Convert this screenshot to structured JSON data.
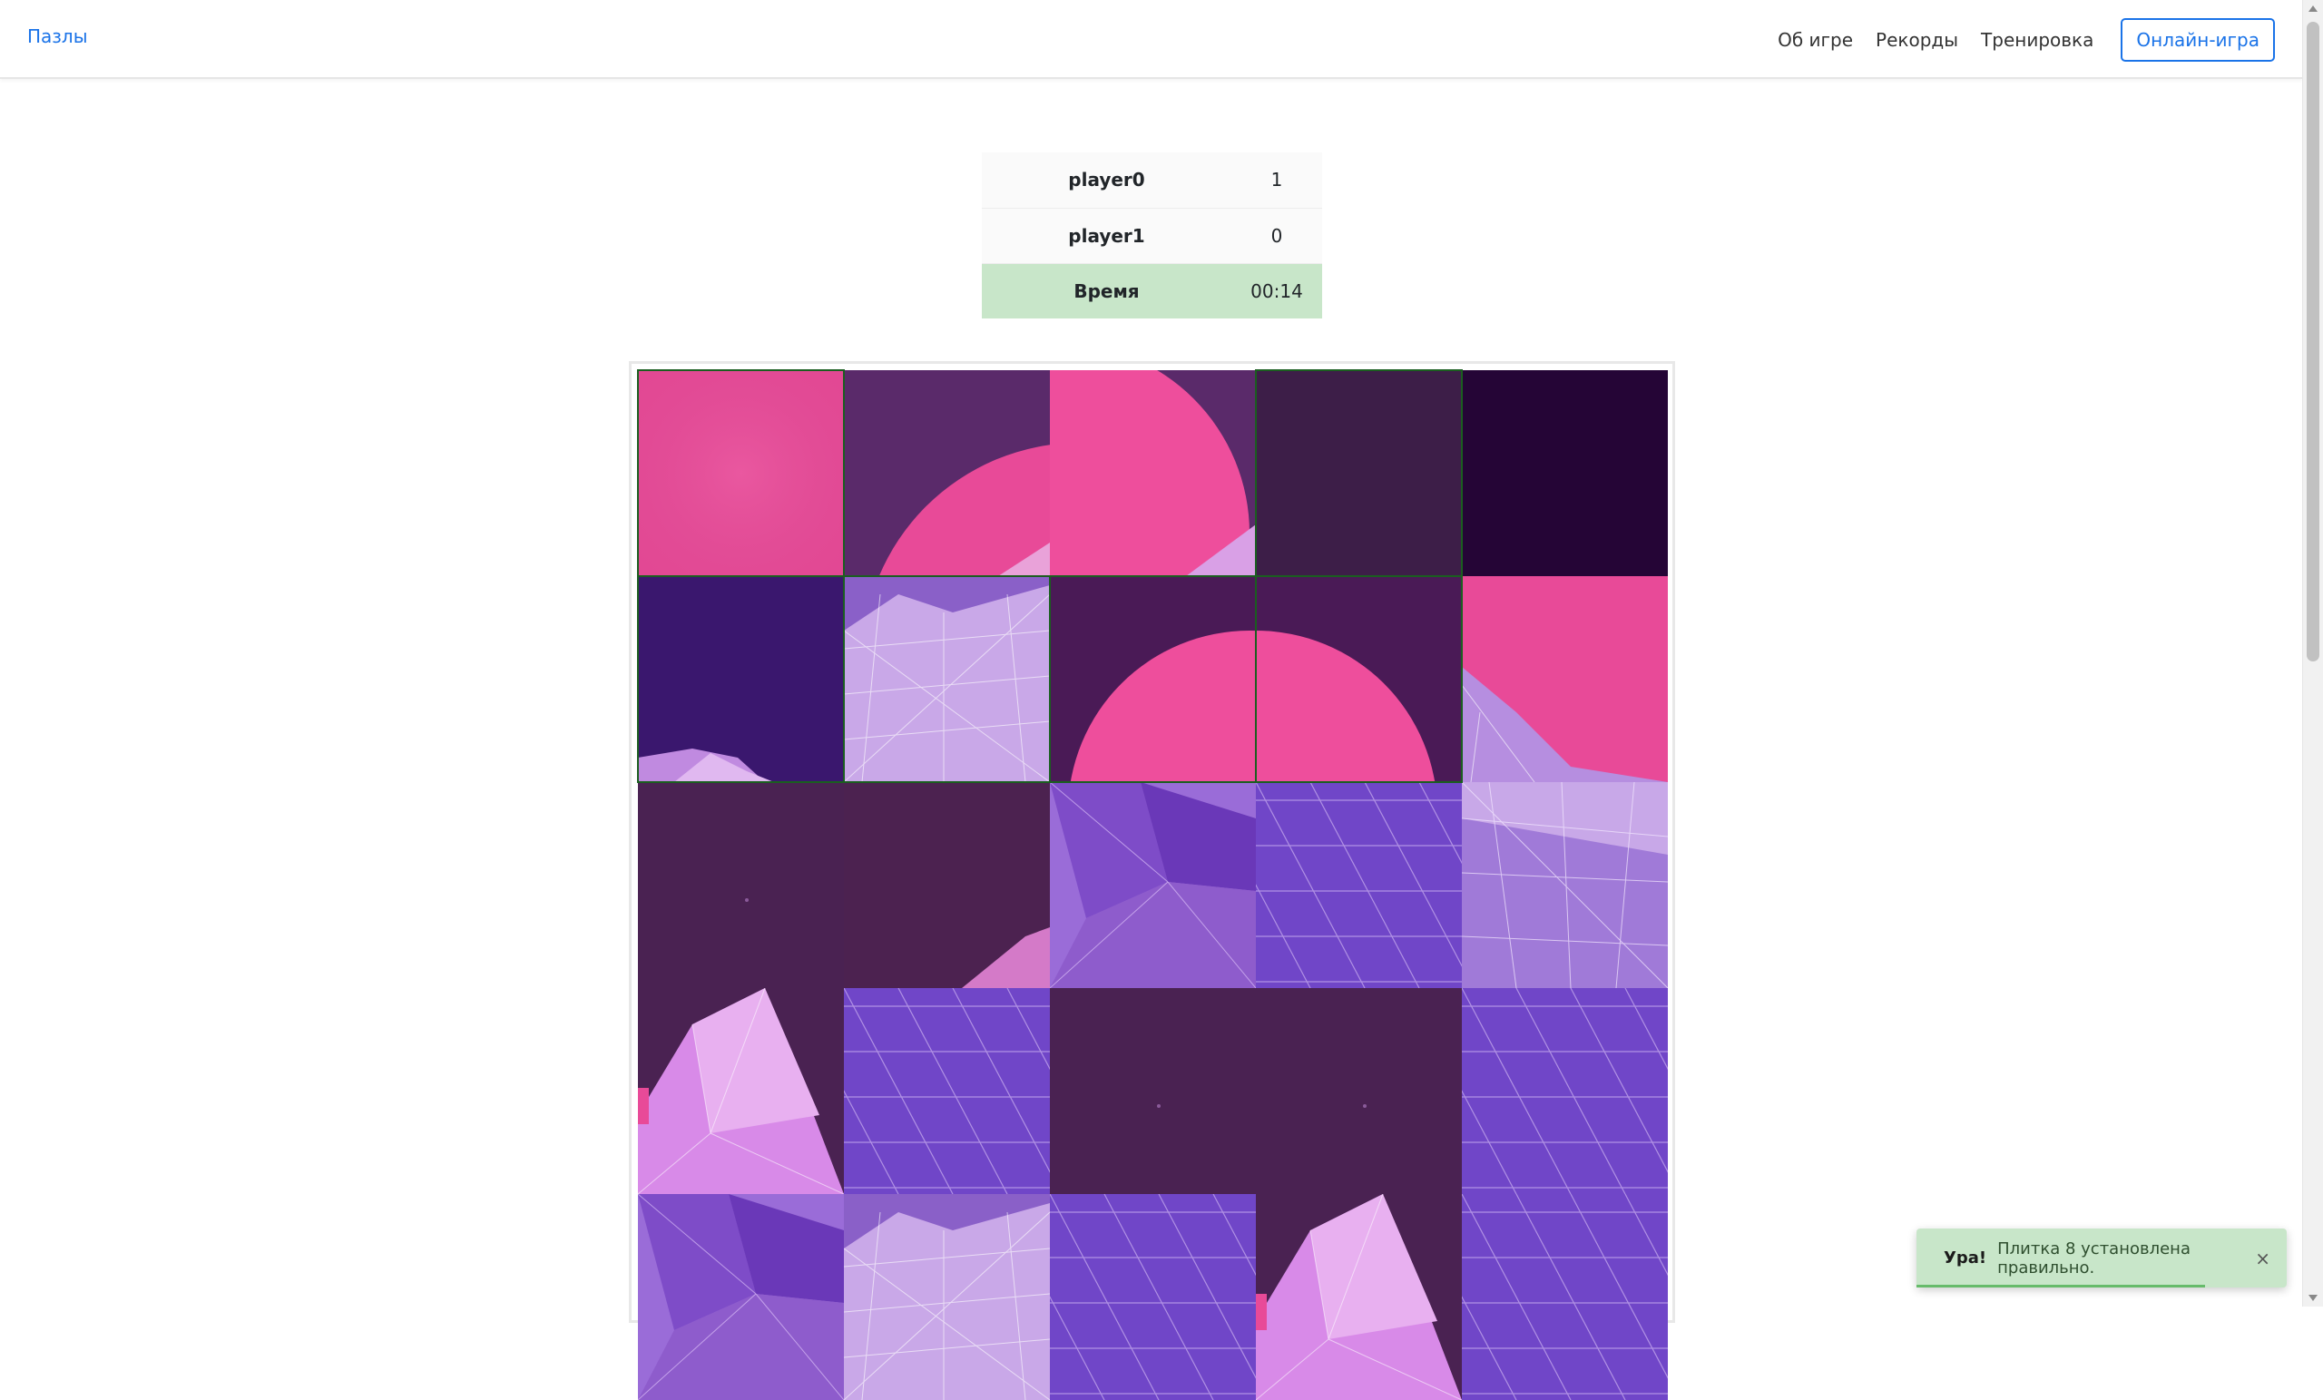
{
  "navbar": {
    "brand": "Пазлы",
    "links": [
      "Об игре",
      "Рекорды",
      "Тренировка"
    ],
    "online_button": "Онлайн-игра"
  },
  "scoreboard": {
    "players": [
      {
        "name": "player0",
        "score": "1"
      },
      {
        "name": "player1",
        "score": "0"
      }
    ],
    "time_label": "Время",
    "time_value": "00:14"
  },
  "puzzle": {
    "grid": "5x5",
    "tiles": [
      {
        "piece": "pink-top-left",
        "placed": true
      },
      {
        "piece": "circle-edge",
        "placed": false
      },
      {
        "piece": "circle-right",
        "placed": false
      },
      {
        "piece": "dark-plain",
        "placed": true
      },
      {
        "piece": "dark-corner",
        "placed": false
      },
      {
        "piece": "purple-lowpoly",
        "placed": true
      },
      {
        "piece": "wire-mountain",
        "placed": true
      },
      {
        "piece": "circle-arc",
        "placed": true
      },
      {
        "piece": "circle-arc-right",
        "placed": true
      },
      {
        "piece": "pink-mountain",
        "placed": false
      },
      {
        "piece": "dark-haze",
        "placed": false
      },
      {
        "piece": "dark-slope",
        "placed": false
      },
      {
        "piece": "lowpoly-light",
        "placed": false
      },
      {
        "piece": "grid-floor",
        "placed": false
      },
      {
        "piece": "lowpoly-wire",
        "placed": false
      },
      {
        "piece": "pink-peak",
        "placed": false
      },
      {
        "piece": "grid-floor",
        "placed": false
      },
      {
        "piece": "dark-haze",
        "placed": false
      },
      {
        "piece": "dark-haze",
        "placed": false
      },
      {
        "piece": "grid-floor",
        "placed": false
      },
      {
        "piece": "lowpoly-light",
        "placed": false
      },
      {
        "piece": "wire-mountain",
        "placed": false
      },
      {
        "piece": "grid-floor",
        "placed": false
      },
      {
        "piece": "pink-peak",
        "placed": false
      },
      {
        "piece": "grid-floor",
        "placed": false
      }
    ]
  },
  "toast": {
    "title": "Ура!",
    "message": "Плитка 8 установлена правильно.",
    "close": "×",
    "progress": 0.78
  },
  "colors": {
    "accent": "#1a73e8",
    "success_bg": "#c8e6c9",
    "tile_border": "#1b5e20"
  }
}
